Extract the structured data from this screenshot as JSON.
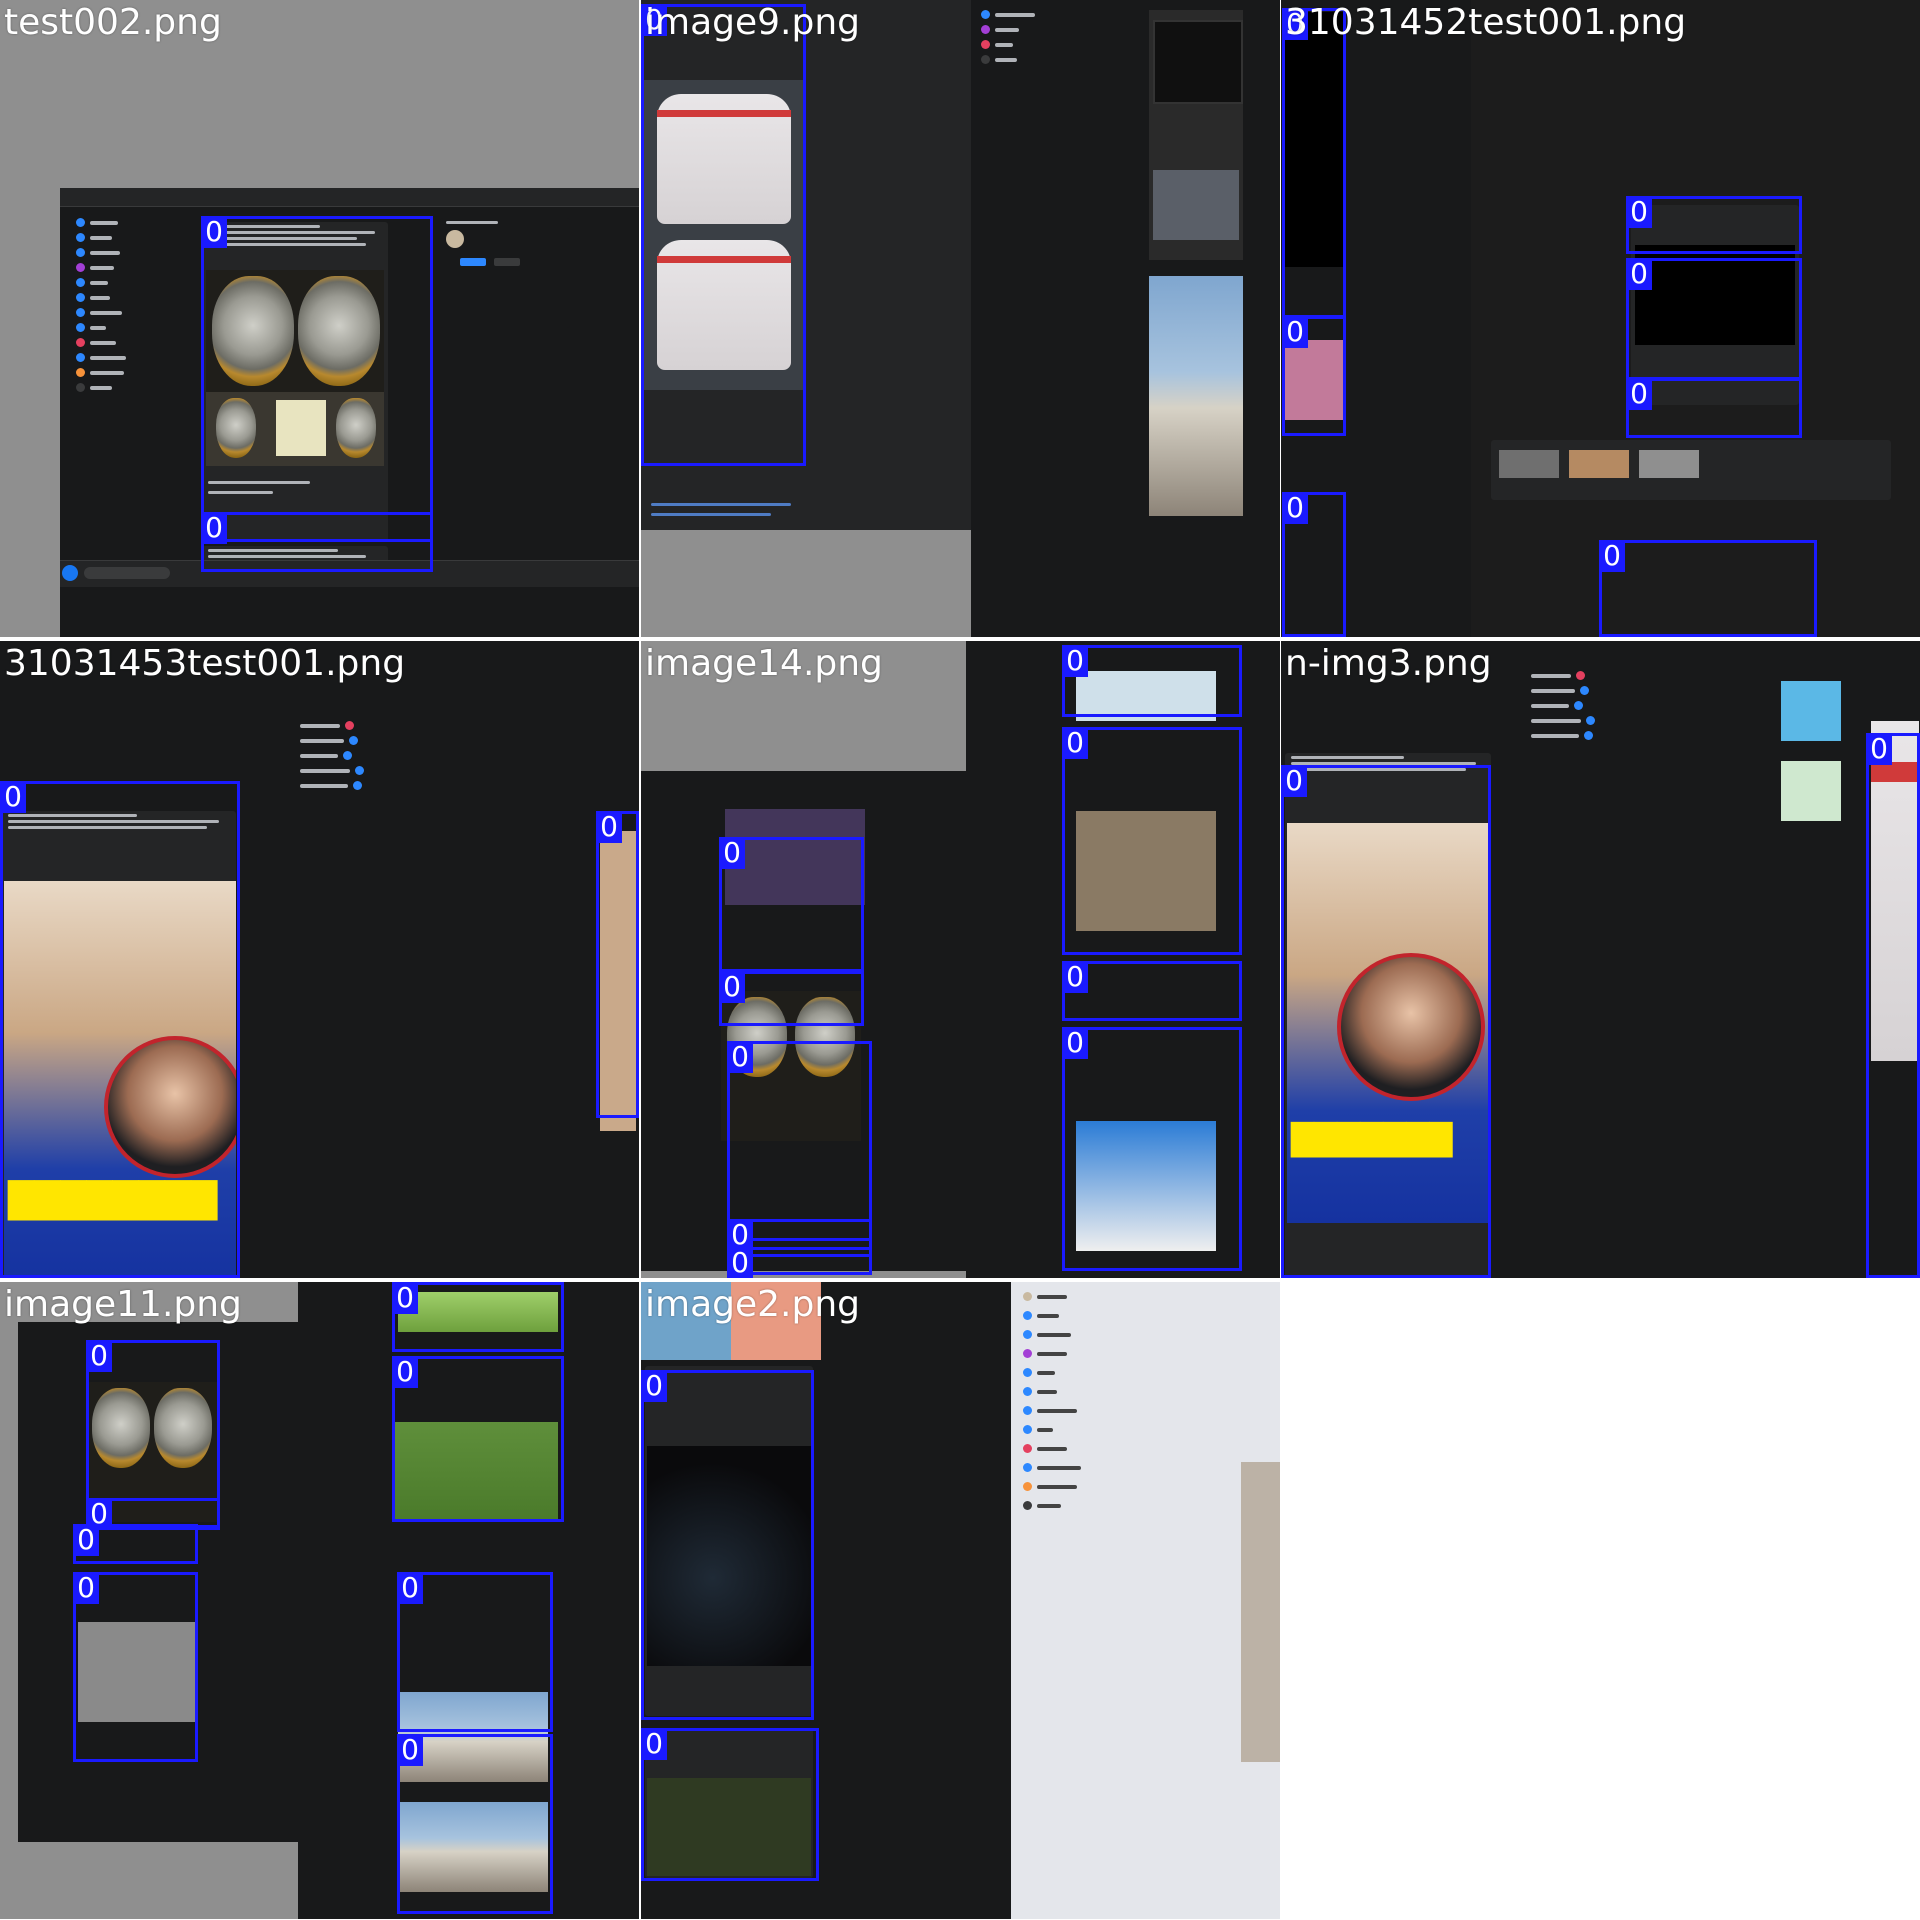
{
  "tiles": [
    {
      "filename": "test002.png",
      "labels": [
        "0",
        "0"
      ]
    },
    {
      "filename": "image9.png",
      "labels": [
        "0"
      ]
    },
    {
      "filename": "31031452test001.png",
      "labels": [
        "0",
        "0",
        "0",
        "0",
        "0",
        "0",
        "0"
      ]
    },
    {
      "filename": "31031453test001.png",
      "labels": [
        "0",
        "0"
      ]
    },
    {
      "filename": "image14.png",
      "labels": [
        "0",
        "0",
        "0",
        "0",
        "0",
        "0",
        "0",
        "0",
        "0"
      ]
    },
    {
      "filename": "n-img3.png",
      "labels": [
        "0",
        "0"
      ]
    },
    {
      "filename": "image11.png",
      "labels": [
        "0",
        "0",
        "0",
        "0",
        "0",
        "0",
        "0",
        "0"
      ]
    },
    {
      "filename": "image2.png",
      "labels": [
        "0",
        "0"
      ]
    }
  ],
  "colors": {
    "bbox": "#1a1aff",
    "canvas": "#8f8f8f",
    "fb_dark": "#18191a",
    "fb_panel": "#242526",
    "fb_blue": "#2d88ff"
  }
}
